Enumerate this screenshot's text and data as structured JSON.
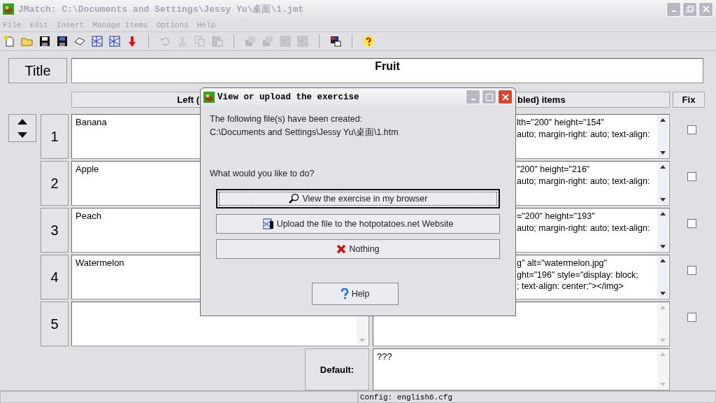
{
  "window": {
    "title": "JMatch: C:\\Documents and Settings\\Jessy Yu\\桌面\\1.jmt"
  },
  "menu": [
    {
      "label": "File",
      "disabled": true
    },
    {
      "label": "Edit",
      "disabled": true
    },
    {
      "label": "Insert",
      "disabled": true
    },
    {
      "label": "Manage Items",
      "disabled": true
    },
    {
      "label": "Options",
      "disabled": true
    },
    {
      "label": "Help",
      "disabled": true
    }
  ],
  "toolbar": [
    {
      "kind": "new",
      "disabled": false
    },
    {
      "kind": "open",
      "disabled": false
    },
    {
      "kind": "save",
      "disabled": false
    },
    {
      "kind": "save-as",
      "disabled": false
    },
    {
      "kind": "eraser",
      "disabled": false
    },
    {
      "kind": "web",
      "disabled": false
    },
    {
      "kind": "web",
      "disabled": false
    },
    {
      "kind": "arrow",
      "disabled": false
    },
    {
      "kind": "sep"
    },
    {
      "kind": "undo",
      "disabled": true
    },
    {
      "kind": "cut",
      "disabled": true
    },
    {
      "kind": "copy",
      "disabled": true
    },
    {
      "kind": "paste",
      "disabled": true
    },
    {
      "kind": "sep"
    },
    {
      "kind": "stack",
      "disabled": true
    },
    {
      "kind": "stack",
      "disabled": true
    },
    {
      "kind": "web",
      "disabled": true
    },
    {
      "kind": "web",
      "disabled": true
    },
    {
      "kind": "sep"
    },
    {
      "kind": "config",
      "disabled": false
    },
    {
      "kind": "sep"
    },
    {
      "kind": "help",
      "disabled": false
    }
  ],
  "title_button": "Title",
  "title_value": "Fruit",
  "left_header": "Left (",
  "right_header": "bled) items",
  "fix_header": "Fix",
  "rows": [
    {
      "number": "1",
      "left": "Banana",
      "right": [
        "lth=\"200\" height=\"154\"",
        "auto; margin-right: auto; text-align:"
      ],
      "fixed": false
    },
    {
      "number": "2",
      "left": "Apple",
      "right": [
        "\"200\" height=\"216\"",
        "auto; margin-right: auto; text-align:"
      ],
      "fixed": false
    },
    {
      "number": "3",
      "left": "Peach",
      "right": [
        "=\"200\" height=\"193\"",
        "auto; margin-right: auto; text-align:"
      ],
      "fixed": false
    },
    {
      "number": "4",
      "left": "Watermelon",
      "right": [
        "g\" alt=\"watermelon.jpg\"",
        "ght=\"196\" style=\"display: block;",
        "; text-align: center;\"></img>"
      ],
      "fixed": false
    },
    {
      "number": "5",
      "left": "",
      "right": [],
      "fixed": false
    }
  ],
  "default_label": "Default:",
  "default_value": "???",
  "status_bar": {
    "config": "Config: english6.cfg"
  },
  "dialog": {
    "title": "View or upload the exercise",
    "line1": "The following file(s) have been created:",
    "line2": "C:\\Documents and Settings\\Jessy Yu\\桌面\\1.htm",
    "question": "What would you like to do?",
    "buttons": [
      {
        "kind": "view",
        "label": "View the exercise in my browser",
        "focused": true
      },
      {
        "kind": "upload",
        "label": "Upload the file to the hotpotatoes.net Website",
        "focused": false
      },
      {
        "kind": "nothing",
        "label": "Nothing",
        "focused": false
      }
    ],
    "help": "Help"
  }
}
